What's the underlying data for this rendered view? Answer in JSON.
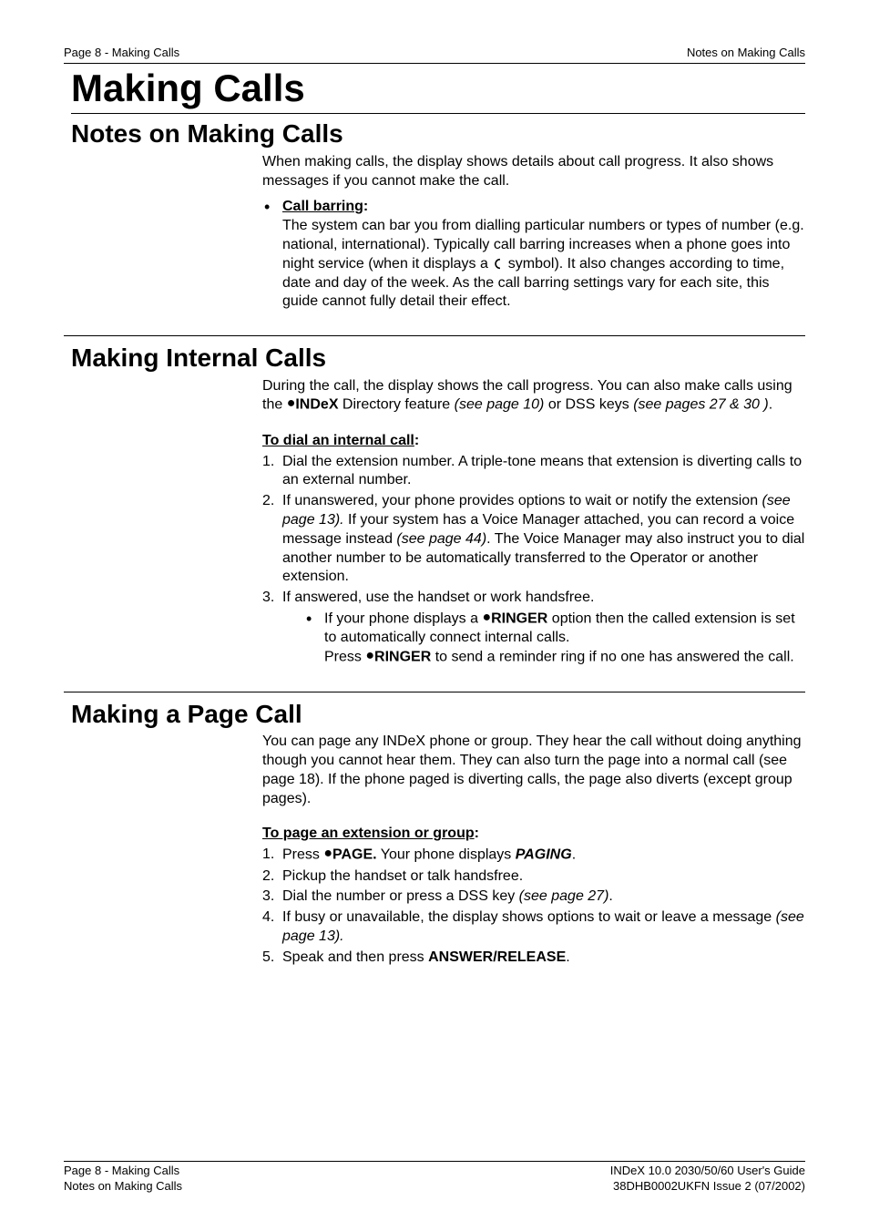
{
  "header": {
    "left": "Page 8 - Making Calls",
    "right": "Notes on Making Calls"
  },
  "chapter_title": "Making Calls",
  "sections": {
    "notes": {
      "title": "Notes on Making Calls",
      "intro": "When making calls, the display shows details about call progress. It also shows messages if you cannot make the call.",
      "bullet": {
        "label": "Call barring",
        "colon": ":",
        "text_before_symbol": "The system can bar you from dialling particular numbers or types of number (e.g. national, international). Typically call barring increases when a phone goes into night service (when it displays a ",
        "text_after_symbol": " symbol). It also changes according to time, date and day of the week. As the call barring settings vary for each site, this guide cannot fully detail their effect."
      }
    },
    "internal": {
      "title": "Making Internal Calls",
      "intro_before_index": "During the call, the display shows the call progress. You can also make calls using the ",
      "index_label": "INDeX",
      "intro_mid": " Directory feature ",
      "ref1": "(see page 10)",
      "intro_mid2": " or DSS keys ",
      "ref2": "(see pages 27 & 30 )",
      "intro_end": ".",
      "sub_heading": "To dial an internal call",
      "sub_colon": ":",
      "steps": {
        "s1": "Dial the extension number. A triple-tone means that extension is diverting calls to an external number.",
        "s2_a": "If unanswered, your phone provides options to wait or notify the extension ",
        "s2_ref1": "(see page 13).",
        "s2_b": " If your system has a Voice Manager attached, you can record a voice message instead ",
        "s2_ref2": "(see page 44)",
        "s2_c": ". The Voice Manager may also instruct you to dial another number to be automatically transferred to the Operator or another extension.",
        "s3": "If answered, use the handset or work handsfree.",
        "s3_sub_a": "If your phone displays a ",
        "s3_sub_ringer": "RINGER",
        "s3_sub_b": " option then the called extension is set to automatically connect internal calls.",
        "s3_sub_c_a": "Press ",
        "s3_sub_c_ringer": "RINGER",
        "s3_sub_c_b": " to send a reminder ring if no one has answered the call."
      }
    },
    "page_call": {
      "title": "Making a Page Call",
      "intro": "You can page any INDeX phone or group. They hear the call without doing anything though you cannot hear them. They can also turn the page into a normal call (see page 18). If the phone paged is diverting calls, the page also diverts (except group pages).",
      "sub_heading": "To page an extension or group",
      "sub_colon": ":",
      "steps": {
        "s1_a": "Press ",
        "s1_page": "PAGE.",
        "s1_b": " Your phone displays ",
        "s1_paging": "PAGING",
        "s1_c": ".",
        "s2": "Pickup the handset or talk handsfree.",
        "s3_a": "Dial the number or press a DSS key ",
        "s3_ref": "(see page 27)",
        "s3_b": ".",
        "s4_a": "If busy or unavailable, the display shows options to wait or leave a message ",
        "s4_ref": "(see page 13).",
        "s5_a": "Speak and then press ",
        "s5_b": "ANSWER/RELEASE",
        "s5_c": "."
      }
    }
  },
  "footer": {
    "left1": "Page 8 - Making Calls",
    "left2": "Notes on Making Calls",
    "right1": "INDeX 10.0 2030/50/60 User's Guide",
    "right2": "38DHB0002UKFN Issue 2 (07/2002)"
  }
}
